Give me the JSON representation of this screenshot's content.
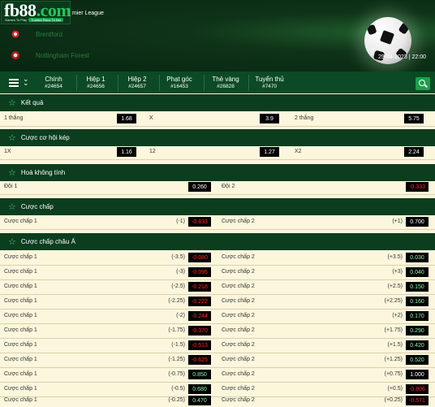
{
  "header": {
    "logo_main": "fb88",
    "logo_suffix": ".com",
    "logo_tag1": "Games To Play",
    "logo_tag2": "Trusted Place To Bet",
    "league": "mier League",
    "home_team": "Brentford",
    "away_team": "Nottingham Forest",
    "datetime": "29-04-2023 | 22:00"
  },
  "tabs": [
    {
      "label": "Chính",
      "count": "#24654"
    },
    {
      "label": "Hiệp 1",
      "count": "#24656"
    },
    {
      "label": "Hiệp 2",
      "count": "#24657"
    },
    {
      "label": "Phạt góc",
      "count": "#16453"
    },
    {
      "label": "Thẻ vàng",
      "count": "#26828"
    },
    {
      "label": "Tuyển thủ",
      "count": "#7470"
    }
  ],
  "sections": {
    "result": {
      "title": "Kết quả",
      "row": {
        "l1": "1 thắng",
        "v1": "1.68",
        "l2": "X",
        "v2": "3.9",
        "l3": "2 thắng",
        "v3": "5.75"
      }
    },
    "double": {
      "title": "Cược cơ hội kép",
      "row": {
        "l1": "1X",
        "v1": "1.16",
        "l2": "12",
        "v2": "1.27",
        "l3": "X2",
        "v3": "2.24"
      }
    },
    "dnb": {
      "title": "Hoà không tính",
      "row": {
        "l1": "Đội 1",
        "v1": "0.260",
        "l2": "Đội 2",
        "v2": "-0.333"
      }
    },
    "handicap": {
      "title": "Cược chấp",
      "row": {
        "l1": "Cược chấp 1",
        "h1": "(-1)",
        "v1": "-0.833",
        "l2": "Cược chấp 2",
        "h2": "(+1)",
        "v2": "0.700"
      }
    },
    "asian": {
      "title": "Cược chấp châu Á",
      "rows": [
        {
          "l1": "Cược chấp 1",
          "h1": "(-3.5)",
          "v1": "-0.080",
          "l2": "Cược chấp 2",
          "h2": "(+3.5)",
          "v2": "0.030"
        },
        {
          "l1": "Cược chấp 1",
          "h1": "(-3)",
          "v1": "-0.095",
          "l2": "Cược chấp 2",
          "h2": "(+3)",
          "v2": "0.040"
        },
        {
          "l1": "Cược chấp 1",
          "h1": "(-2.5)",
          "v1": "-0.218",
          "l2": "Cược chấp 2",
          "h2": "(+2.5)",
          "v2": "0.150"
        },
        {
          "l1": "Cược chấp 1",
          "h1": "(-2.25)",
          "v1": "-0.222",
          "l2": "Cược chấp 2",
          "h2": "(+2.25)",
          "v2": "0.160"
        },
        {
          "l1": "Cược chấp 1",
          "h1": "(-2)",
          "v1": "-0.244",
          "l2": "Cược chấp 2",
          "h2": "(+2)",
          "v2": "0.170"
        },
        {
          "l1": "Cược chấp 1",
          "h1": "(-1.75)",
          "v1": "-0.370",
          "l2": "Cược chấp 2",
          "h2": "(+1.75)",
          "v2": "0.290"
        },
        {
          "l1": "Cược chấp 1",
          "h1": "(-1.5)",
          "v1": "-0.513",
          "l2": "Cược chấp 2",
          "h2": "(+1.5)",
          "v2": "0.420"
        },
        {
          "l1": "Cược chấp 1",
          "h1": "(-1.25)",
          "v1": "-0.625",
          "l2": "Cược chấp 2",
          "h2": "(+1.25)",
          "v2": "0.520"
        },
        {
          "l1": "Cược chấp 1",
          "h1": "(-0.75)",
          "v1": "0.850",
          "l2": "Cược chấp 2",
          "h2": "(+0.75)",
          "v2": "1.000"
        },
        {
          "l1": "Cược chấp 1",
          "h1": "(-0.5)",
          "v1": "0.680",
          "l2": "Cược chấp 2",
          "h2": "(+0.5)",
          "v2": "-0.806"
        },
        {
          "l1": "Cược chấp 1",
          "h1": "(-0.25)",
          "v1": "0.470",
          "l2": "Cược chấp 2",
          "h2": "(+0.25)",
          "v2": "-0.571"
        }
      ]
    }
  },
  "colors": {
    "header_bg": "#072512",
    "tab_bar_bg": "#0b4a24",
    "section_bg": "#0b3d1e",
    "row_bg": "#fbf6dc",
    "odd_bg": "#000000",
    "odd_negative": "#ff2a2a",
    "odd_positive": "#8ff0ae",
    "accent_green": "#1aa14b"
  },
  "icons": [
    "menu-icon",
    "double-chevron-icon",
    "search-icon",
    "star-icon",
    "team-logo",
    "soccer-ball-image"
  ]
}
